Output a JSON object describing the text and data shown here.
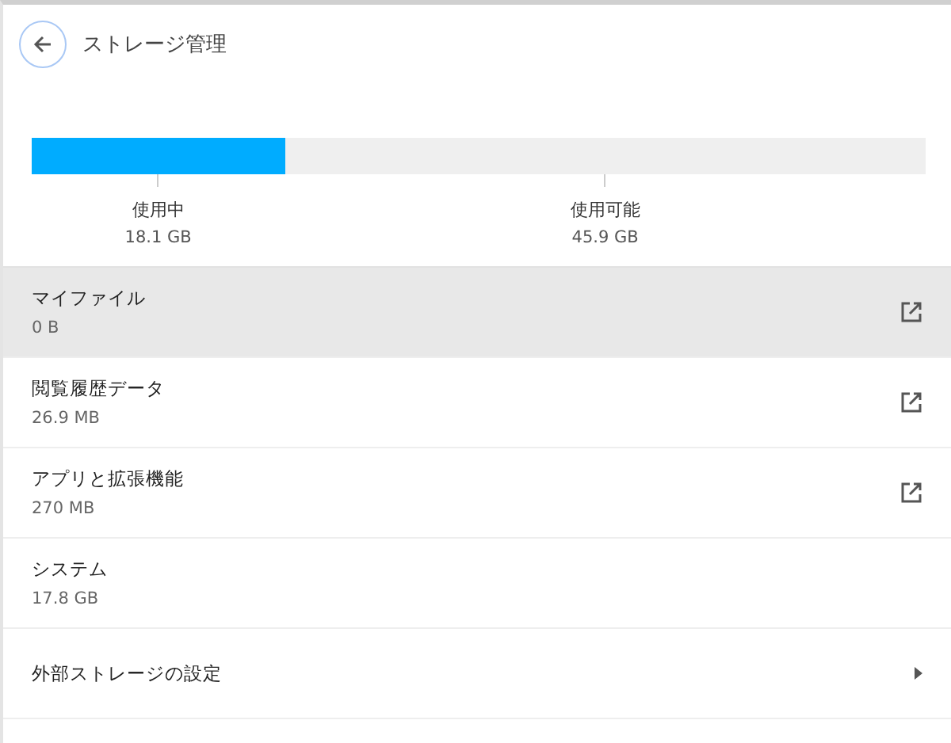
{
  "header": {
    "title": "ストレージ管理"
  },
  "usage": {
    "level": 0.283,
    "used": {
      "label": "使用中",
      "value": "18.1 GB"
    },
    "available": {
      "label": "使用可能",
      "value": "45.9 GB"
    }
  },
  "rows": [
    {
      "kind": "external",
      "title": "マイファイル",
      "size": "0 B",
      "selected": true
    },
    {
      "kind": "external",
      "title": "閲覧履歴データ",
      "size": "26.9 MB",
      "selected": false
    },
    {
      "kind": "external",
      "title": "アプリと拡張機能",
      "size": "270 MB",
      "selected": false
    },
    {
      "kind": "plain",
      "title": "システム",
      "size": "17.8 GB",
      "selected": false
    },
    {
      "kind": "submenu",
      "title": "外部ストレージの設定",
      "selected": false
    }
  ]
}
